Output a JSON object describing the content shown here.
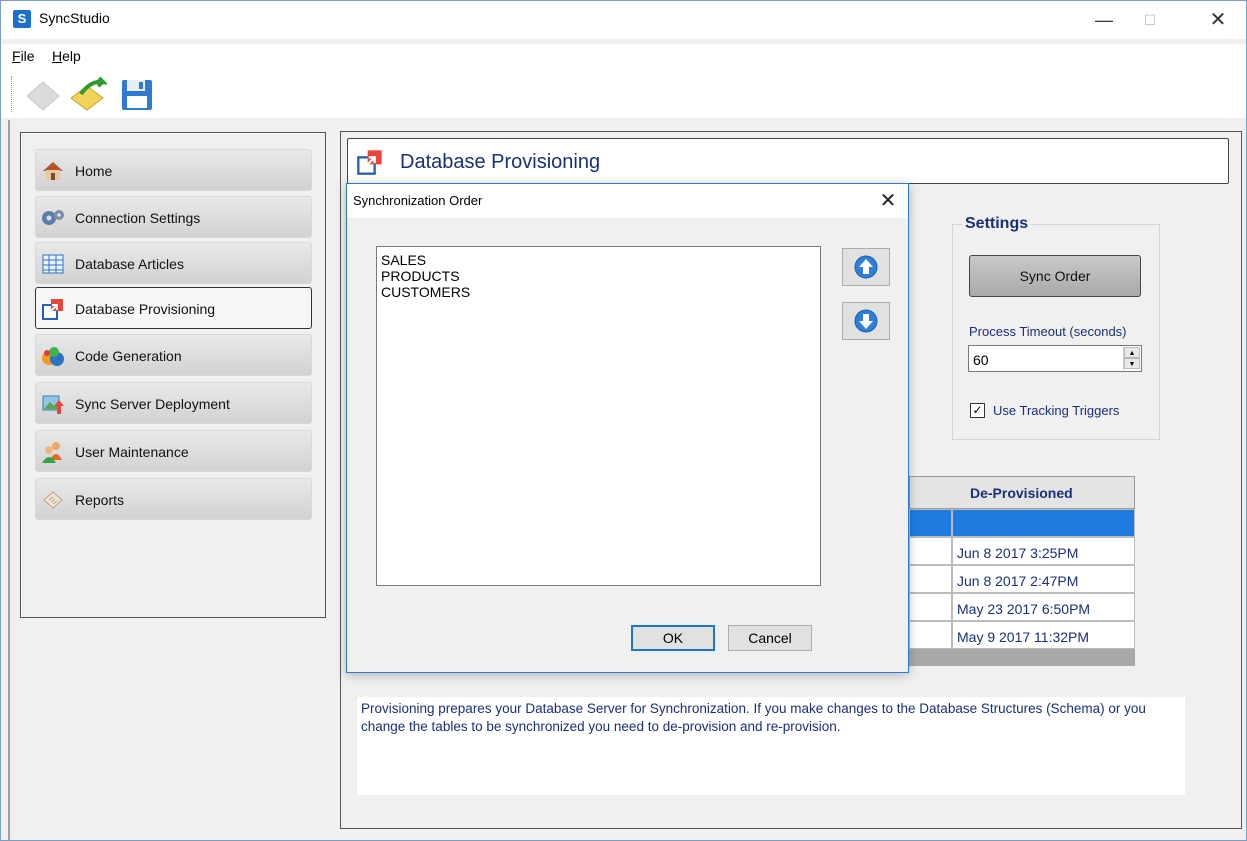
{
  "window": {
    "title": "SyncStudio",
    "icon_letter": "S",
    "minimize": "—",
    "maximize": "☐",
    "close": "✕"
  },
  "menu": [
    {
      "key": "F",
      "rest": "ile"
    },
    {
      "key": "H",
      "rest": "elp"
    }
  ],
  "toolbar": {
    "icons": [
      "new-document-icon",
      "open-folder-icon",
      "save-disk-icon"
    ]
  },
  "nav": {
    "items": [
      {
        "label": "Home",
        "icon": "house-icon",
        "active": false
      },
      {
        "label": "Connection Settings",
        "icon": "gears-icon",
        "active": false
      },
      {
        "label": "Database Articles",
        "icon": "table-grid-icon",
        "active": false
      },
      {
        "label": "Database Provisioning",
        "icon": "provisioning-arrow-icon",
        "active": true
      },
      {
        "label": "Code Generation",
        "icon": "color-balls-icon",
        "active": false
      },
      {
        "label": "Sync Server Deployment",
        "icon": "deploy-upload-icon",
        "active": false
      },
      {
        "label": "User Maintenance",
        "icon": "users-icon",
        "active": false
      },
      {
        "label": "Reports",
        "icon": "report-paper-icon",
        "active": false
      }
    ]
  },
  "page": {
    "title": "Database Provisioning"
  },
  "settings": {
    "title": "Settings",
    "sync_order_label": "Sync Order",
    "timeout_label": "Process Timeout (seconds)",
    "timeout_value": "60",
    "tracking_triggers_label": "Use Tracking Triggers",
    "tracking_triggers_checked": true
  },
  "grid": {
    "header": "De-Provisioned",
    "rows": [
      "",
      "Jun 8 2017 3:25PM",
      "Jun 8 2017 2:47PM",
      "May 23 2017 6:50PM",
      "May 9 2017 11:32PM"
    ]
  },
  "description": "Provisioning prepares your Database Server for Synchronization. If you make changes to the Database Structures (Schema) or you change the tables to be synchronized you need to de-provision and re-provision.",
  "dialog": {
    "title": "Synchronization Order",
    "close": "✕",
    "items": [
      "SALES",
      "PRODUCTS",
      "CUSTOMERS"
    ],
    "ok_label": "OK",
    "cancel_label": "Cancel"
  },
  "colors": {
    "accent_text": "#1a2f7a",
    "selection": "#1e7ce0",
    "dialog_border": "#2e7bd6"
  }
}
